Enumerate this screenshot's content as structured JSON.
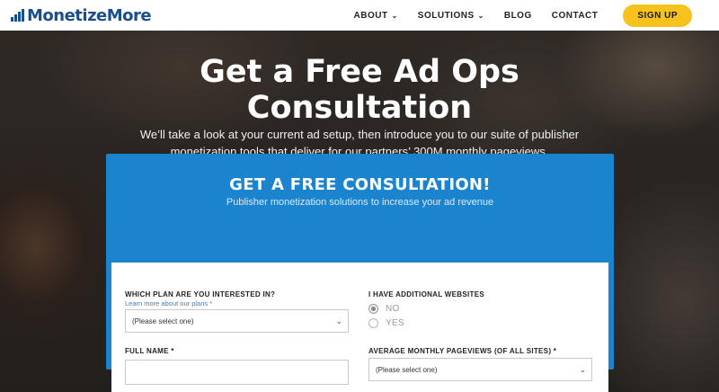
{
  "header": {
    "logo_text": "MonetizeMore",
    "nav": [
      {
        "label": "ABOUT",
        "has_dropdown": true
      },
      {
        "label": "SOLUTIONS",
        "has_dropdown": true
      },
      {
        "label": "BLOG",
        "has_dropdown": false
      },
      {
        "label": "CONTACT",
        "has_dropdown": false
      }
    ],
    "signup_label": "SIGN UP",
    "chevron": "⌄"
  },
  "hero": {
    "title_line1": "Get a Free Ad Ops",
    "title_line2": "Consultation",
    "subtitle_line1": "We’ll take a look at your current ad setup, then introduce you to our suite of publisher",
    "subtitle_line2": "monetization tools that deliver for our partners’ 300M monthly pageviews."
  },
  "form_card": {
    "title": "GET A FREE CONSULTATION!",
    "subtitle": "Publisher monetization solutions to increase your ad revenue"
  },
  "form": {
    "plan": {
      "label": "WHICH PLAN ARE YOU INTERESTED IN?",
      "helper": "Learn more about our plans *",
      "value": "(Please select one)"
    },
    "additional_sites": {
      "label": "I HAVE ADDITIONAL WEBSITES",
      "options": [
        "NO",
        "YES"
      ],
      "selected": "NO"
    },
    "full_name": {
      "label": "FULL NAME *",
      "value": ""
    },
    "pageviews": {
      "label": "AVERAGE MONTHLY PAGEVIEWS (OF ALL SITES) *",
      "value": "(Please select one)"
    }
  },
  "colors": {
    "brand_blue": "#1b4f8c",
    "card_blue": "#1b84cf",
    "signup_yellow": "#f6c21b"
  },
  "icons": [
    "logo-bars-icon",
    "chevron-down-icon",
    "radio-icon"
  ]
}
